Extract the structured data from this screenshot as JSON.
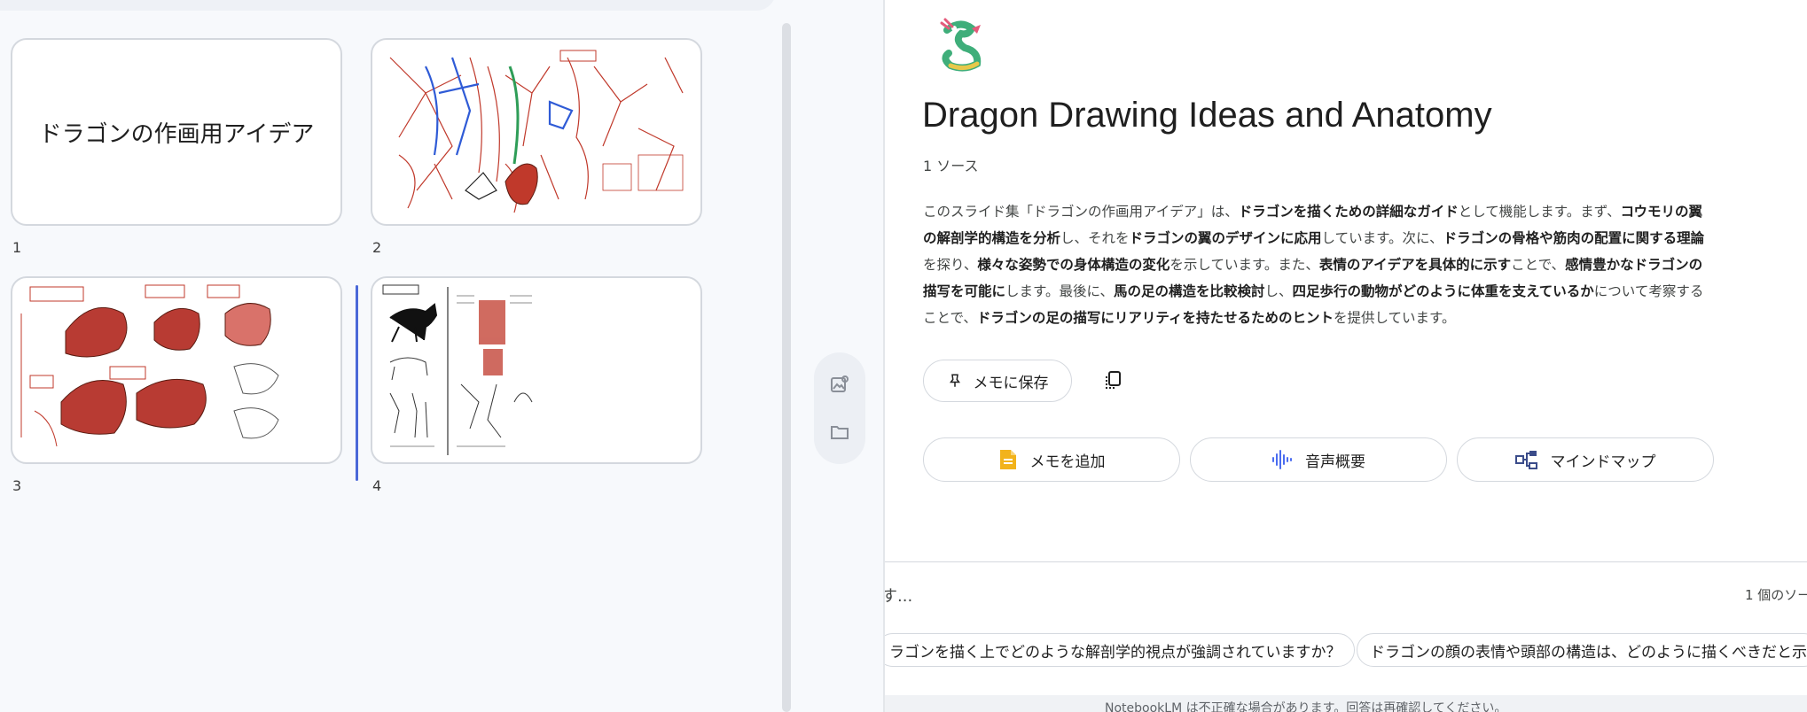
{
  "slides": [
    {
      "number": "1",
      "title": "ドラゴンの作画用アイデア"
    },
    {
      "number": "2"
    },
    {
      "number": "3"
    },
    {
      "number": "4"
    }
  ],
  "notebook": {
    "title": "Dragon Drawing Ideas and Anatomy",
    "source_count": "1 ソース",
    "summary_parts": [
      {
        "text": "このスライド集「ドラゴンの作画用アイデア」は、",
        "bold": false
      },
      {
        "text": "ドラゴンを描くための詳細なガイド",
        "bold": true
      },
      {
        "text": "として機能します。まず、",
        "bold": false
      },
      {
        "text": "コウモリの翼の解剖学的構造を分析",
        "bold": true
      },
      {
        "text": "し、それを",
        "bold": false
      },
      {
        "text": "ドラゴンの翼のデザインに応用",
        "bold": true
      },
      {
        "text": "しています。次に、",
        "bold": false
      },
      {
        "text": "ドラゴンの骨格や筋肉の配置に関する理論",
        "bold": true
      },
      {
        "text": "を探り、",
        "bold": false
      },
      {
        "text": "様々な姿勢での身体構造の変化",
        "bold": true
      },
      {
        "text": "を示しています。また、",
        "bold": false
      },
      {
        "text": "表情のアイデアを具体的に示す",
        "bold": true
      },
      {
        "text": "ことで、",
        "bold": false
      },
      {
        "text": "感情豊かなドラゴンの描写を可能に",
        "bold": true
      },
      {
        "text": "します。最後に、",
        "bold": false
      },
      {
        "text": "馬の足の構造を比較検討",
        "bold": true
      },
      {
        "text": "し、",
        "bold": false
      },
      {
        "text": "四足歩行の動物がどのように体重を支えているか",
        "bold": true
      },
      {
        "text": "について考察することで、",
        "bold": false
      },
      {
        "text": "ドラゴンの足の描写にリアリティを持たせるためのヒント",
        "bold": true
      },
      {
        "text": "を提供しています。",
        "bold": false
      }
    ],
    "save_note_label": "メモに保存",
    "actions": [
      {
        "label": "メモを追加",
        "icon": "note-icon"
      },
      {
        "label": "音声概要",
        "icon": "audio-waveform-icon"
      },
      {
        "label": "マインドマップ",
        "icon": "mind-map-icon"
      }
    ]
  },
  "chat": {
    "input_partial_text": "す...",
    "source_count": "1 個のソー",
    "suggestions": [
      "ラゴンを描く上でどのような解剖学的視点が強調されていますか？",
      "ドラゴンの顔の表情や頭部の構造は、どのように描くべきだと示"
    ],
    "disclaimer": "NotebookLM は不正確な場合があります。回答は再確認してください。"
  },
  "colors": {
    "accent_blue": "#4a68d8",
    "note_icon_yellow": "#f2b31b",
    "waveform_blue": "#4a6cf0",
    "mindmap_navy": "#3b4c8a",
    "sketch_red": "#c0392b"
  }
}
